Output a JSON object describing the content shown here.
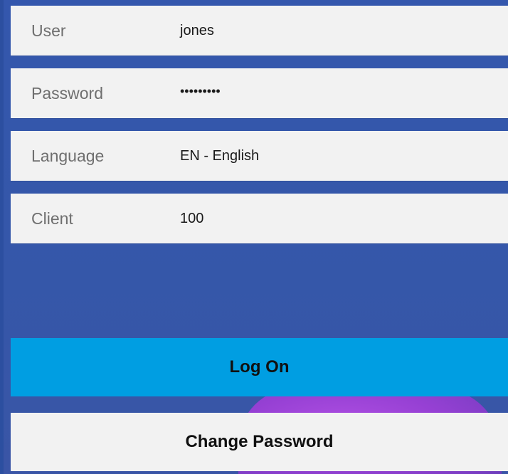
{
  "form": {
    "fields": [
      {
        "label": "User",
        "value": "jones"
      },
      {
        "label": "Password",
        "value": "•••••••••"
      },
      {
        "label": "Language",
        "value": "EN - English"
      },
      {
        "label": "Client",
        "value": "100"
      }
    ]
  },
  "buttons": {
    "logon_label": "Log On",
    "change_password_label": "Change Password"
  },
  "colors": {
    "background_blue": "#3457ad",
    "logon_button": "#009ee2",
    "field_background": "#f2f2f2",
    "background_blob": "#9b3fd6"
  }
}
